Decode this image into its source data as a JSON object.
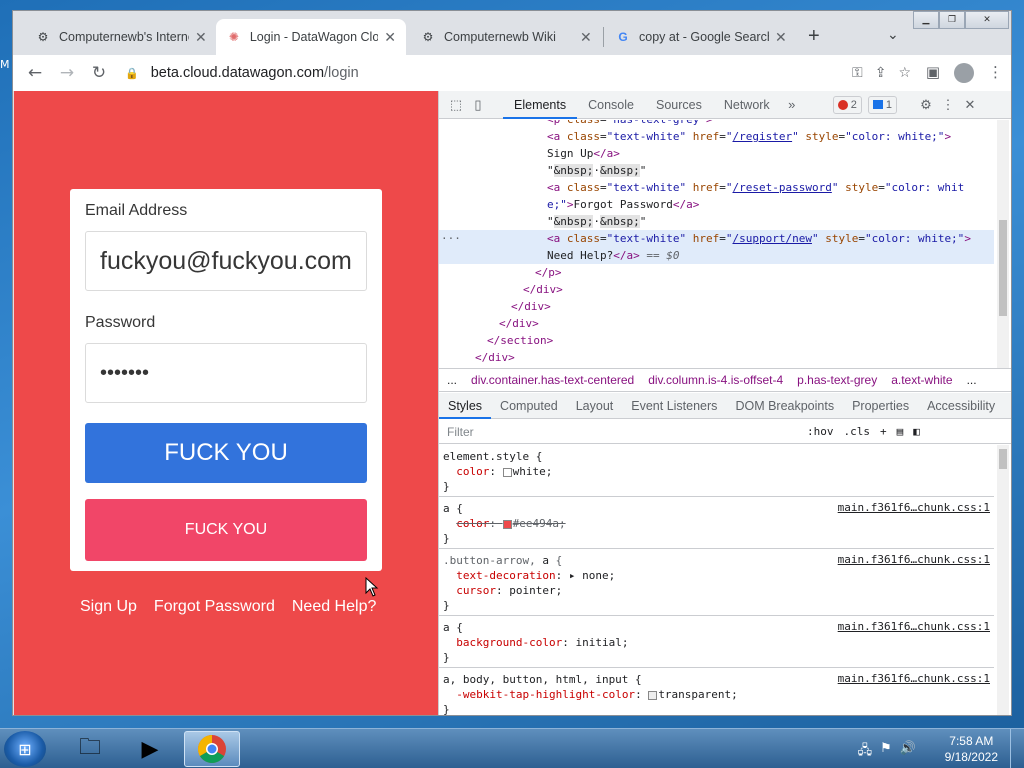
{
  "browser": {
    "tabs": [
      {
        "title": "Computernewb's Interne",
        "active": false
      },
      {
        "title": "Login - DataWagon Clou",
        "active": true
      },
      {
        "title": "Computernewb Wiki",
        "active": false
      },
      {
        "title": "copy at - Google Search",
        "active": false
      }
    ],
    "url_host": "beta.cloud.datawagon.com",
    "url_path": "/login"
  },
  "page": {
    "email_label": "Email Address",
    "email_value": "fuckyou@fuckyou.com",
    "password_label": "Password",
    "password_value": "•••••••",
    "primary_button": "FUCK YOU",
    "secondary_button": "FUCK YOU",
    "links": [
      "Sign Up",
      "Forgot Password",
      "Need Help?"
    ],
    "background_color": "#ee494a"
  },
  "devtools": {
    "tabs": [
      "Elements",
      "Console",
      "Sources",
      "Network"
    ],
    "active_tab": "Elements",
    "error_count": "2",
    "info_count": "1",
    "breadcrumbs": [
      "...",
      "div.container.has-text-centered",
      "div.column.is-4.is-offset-4",
      "p.has-text-grey",
      "a.text-white",
      "..."
    ],
    "style_tabs": [
      "Styles",
      "Computed",
      "Layout",
      "Event Listeners",
      "DOM Breakpoints",
      "Properties",
      "Accessibility"
    ],
    "filter_placeholder": "Filter",
    "filter_hov": ":hov",
    "filter_cls": ".cls",
    "rule_source": "main.f361f6…chunk.css:1"
  },
  "taskbar": {
    "time": "7:58 AM",
    "date": "9/18/2022"
  }
}
